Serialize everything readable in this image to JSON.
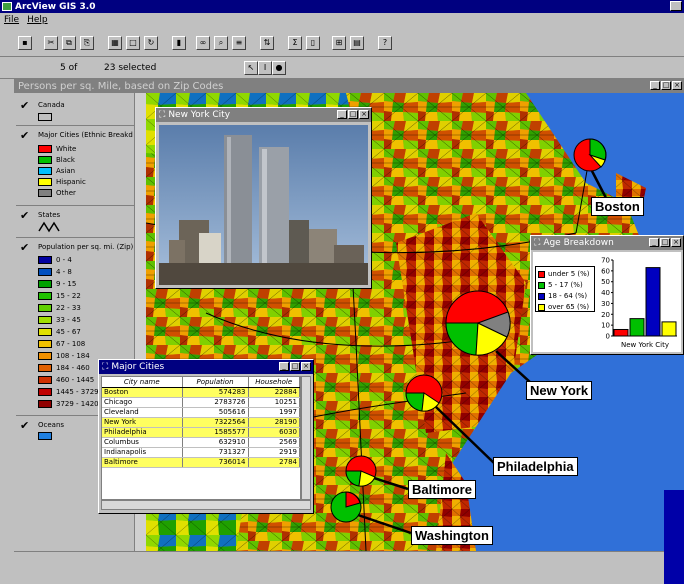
{
  "app": {
    "title": "ArcView GIS 3.0"
  },
  "menu": [
    {
      "label": "File"
    },
    {
      "label": "Help"
    }
  ],
  "status": {
    "scale": "5 of",
    "selected": "23 selected"
  },
  "map_window": {
    "title": "Persons per sq. Mile, based on Zip Codes"
  },
  "legend": {
    "canada": {
      "label": "Canada",
      "color": "#c0c0c0"
    },
    "cities": {
      "title": "Major Cities (Ethnic Breakd",
      "items": [
        {
          "label": "White",
          "color": "#ff0000"
        },
        {
          "label": "Black",
          "color": "#00c000"
        },
        {
          "label": "Asian",
          "color": "#00c0ff"
        },
        {
          "label": "Hispanic",
          "color": "#ffff00"
        },
        {
          "label": "Other",
          "color": "#808080"
        }
      ]
    },
    "states": {
      "label": "States"
    },
    "population": {
      "title": "Population per sq. mi. (Zip)",
      "items": [
        {
          "label": "0 - 4",
          "color": "#0000a0"
        },
        {
          "label": "4 - 8",
          "color": "#0050c0"
        },
        {
          "label": "9 - 15",
          "color": "#00a000"
        },
        {
          "label": "15 - 22",
          "color": "#20c000"
        },
        {
          "label": "22 - 33",
          "color": "#60d000"
        },
        {
          "label": "33 - 45",
          "color": "#a0e000"
        },
        {
          "label": "45 - 67",
          "color": "#e0e000"
        },
        {
          "label": "67 - 108",
          "color": "#f0c000"
        },
        {
          "label": "108 - 184",
          "color": "#f09000"
        },
        {
          "label": "184 - 460",
          "color": "#e06000"
        },
        {
          "label": "460 - 1445",
          "color": "#d03000"
        },
        {
          "label": "1445 - 3729",
          "color": "#c00000"
        },
        {
          "label": "3729 - 1420",
          "color": "#900000"
        }
      ]
    },
    "oceans": {
      "label": "Oceans",
      "color": "#2080e0"
    }
  },
  "photo_window": {
    "title": "New York City"
  },
  "major_cities": {
    "title": "Major Cities",
    "columns": [
      "City name",
      "Population",
      "Househole"
    ],
    "rows": [
      {
        "city": "Boston",
        "pop": "574283",
        "hh": "22884",
        "highlight": true
      },
      {
        "city": "Chicago",
        "pop": "2783726",
        "hh": "10251",
        "highlight": false
      },
      {
        "city": "Cleveland",
        "pop": "505616",
        "hh": "1997",
        "highlight": false
      },
      {
        "city": "New York",
        "pop": "7322564",
        "hh": "28190",
        "highlight": true
      },
      {
        "city": "Philadelphia",
        "pop": "1585577",
        "hh": "6030",
        "highlight": true
      },
      {
        "city": "Columbus",
        "pop": "632910",
        "hh": "2569",
        "highlight": false
      },
      {
        "city": "Indianapolis",
        "pop": "731327",
        "hh": "2919",
        "highlight": false
      },
      {
        "city": "Baltimore",
        "pop": "736014",
        "hh": "2784",
        "highlight": true
      }
    ]
  },
  "age_window": {
    "title": "Age Breakdown",
    "legend": [
      {
        "label": "under 5 (%)",
        "color": "#ff0000"
      },
      {
        "label": "5 - 17 (%)",
        "color": "#00c000"
      },
      {
        "label": "18 - 64 (%)",
        "color": "#0000c0"
      },
      {
        "label": "over 65 (%)",
        "color": "#ffff00"
      }
    ],
    "chart_data": {
      "type": "bar",
      "categories": [
        "under 5 (%)",
        "5 - 17 (%)",
        "18 - 64 (%)",
        "over 65 (%)"
      ],
      "values": [
        6,
        16,
        63,
        13
      ],
      "colors": [
        "#ff0000",
        "#00c000",
        "#0000c0",
        "#ffff00"
      ],
      "ticks": [
        "0",
        "10",
        "20",
        "30",
        "40",
        "50",
        "60",
        "70"
      ],
      "ylim": [
        0,
        70
      ],
      "xlabel": "New York City"
    }
  },
  "city_labels": [
    {
      "label": "Boston"
    },
    {
      "label": "New York"
    },
    {
      "label": "Philadelphia"
    },
    {
      "label": "Baltimore"
    },
    {
      "label": "Washington"
    }
  ]
}
